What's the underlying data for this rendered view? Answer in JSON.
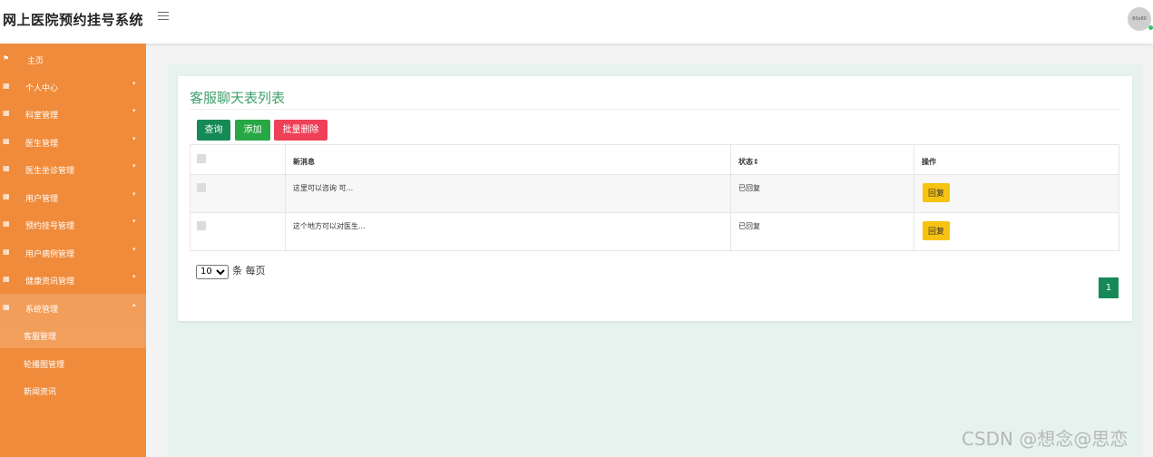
{
  "header": {
    "title": "网上医院预约挂号系统",
    "avatar_text": "80x80"
  },
  "sidebar": {
    "items": [
      {
        "label": "主页",
        "icon": "flag-icon"
      },
      {
        "label": "个人中心",
        "icon": "grid-icon"
      },
      {
        "label": "科室管理",
        "icon": "grid-icon"
      },
      {
        "label": "医生管理",
        "icon": "grid-icon"
      },
      {
        "label": "医生坐诊管理",
        "icon": "grid-icon"
      },
      {
        "label": "用户管理",
        "icon": "grid-icon"
      },
      {
        "label": "预约挂号管理",
        "icon": "grid-icon"
      },
      {
        "label": "用户病例管理",
        "icon": "grid-icon"
      },
      {
        "label": "健康资讯管理",
        "icon": "grid-icon"
      },
      {
        "label": "系统管理",
        "icon": "grid-icon"
      }
    ],
    "sub_items": [
      {
        "label": "客服管理"
      },
      {
        "label": "轮播图管理"
      },
      {
        "label": "新闻资讯"
      }
    ]
  },
  "panel": {
    "title": "客服聊天表列表",
    "buttons": {
      "query": "查询",
      "add": "添加",
      "batch_delete": "批量删除"
    }
  },
  "table": {
    "columns": [
      "新消息",
      "状态",
      "操作"
    ],
    "rows": [
      {
        "message": "这里可以咨询 可...",
        "status": "已回复",
        "action": "回复"
      },
      {
        "message": "这个地方可以对医生...",
        "status": "已回复",
        "action": "回复"
      }
    ]
  },
  "pagination": {
    "page_size": "10",
    "per_page_label": "条 每页",
    "current_page": "1"
  },
  "watermark": "CSDN @想念@思恋",
  "colors": {
    "sidebar": "#ef8b3b",
    "primary": "#158a56",
    "success": "#28a745",
    "danger": "#ee4157",
    "warning": "#f7c312",
    "title_green": "#3ea06a"
  }
}
